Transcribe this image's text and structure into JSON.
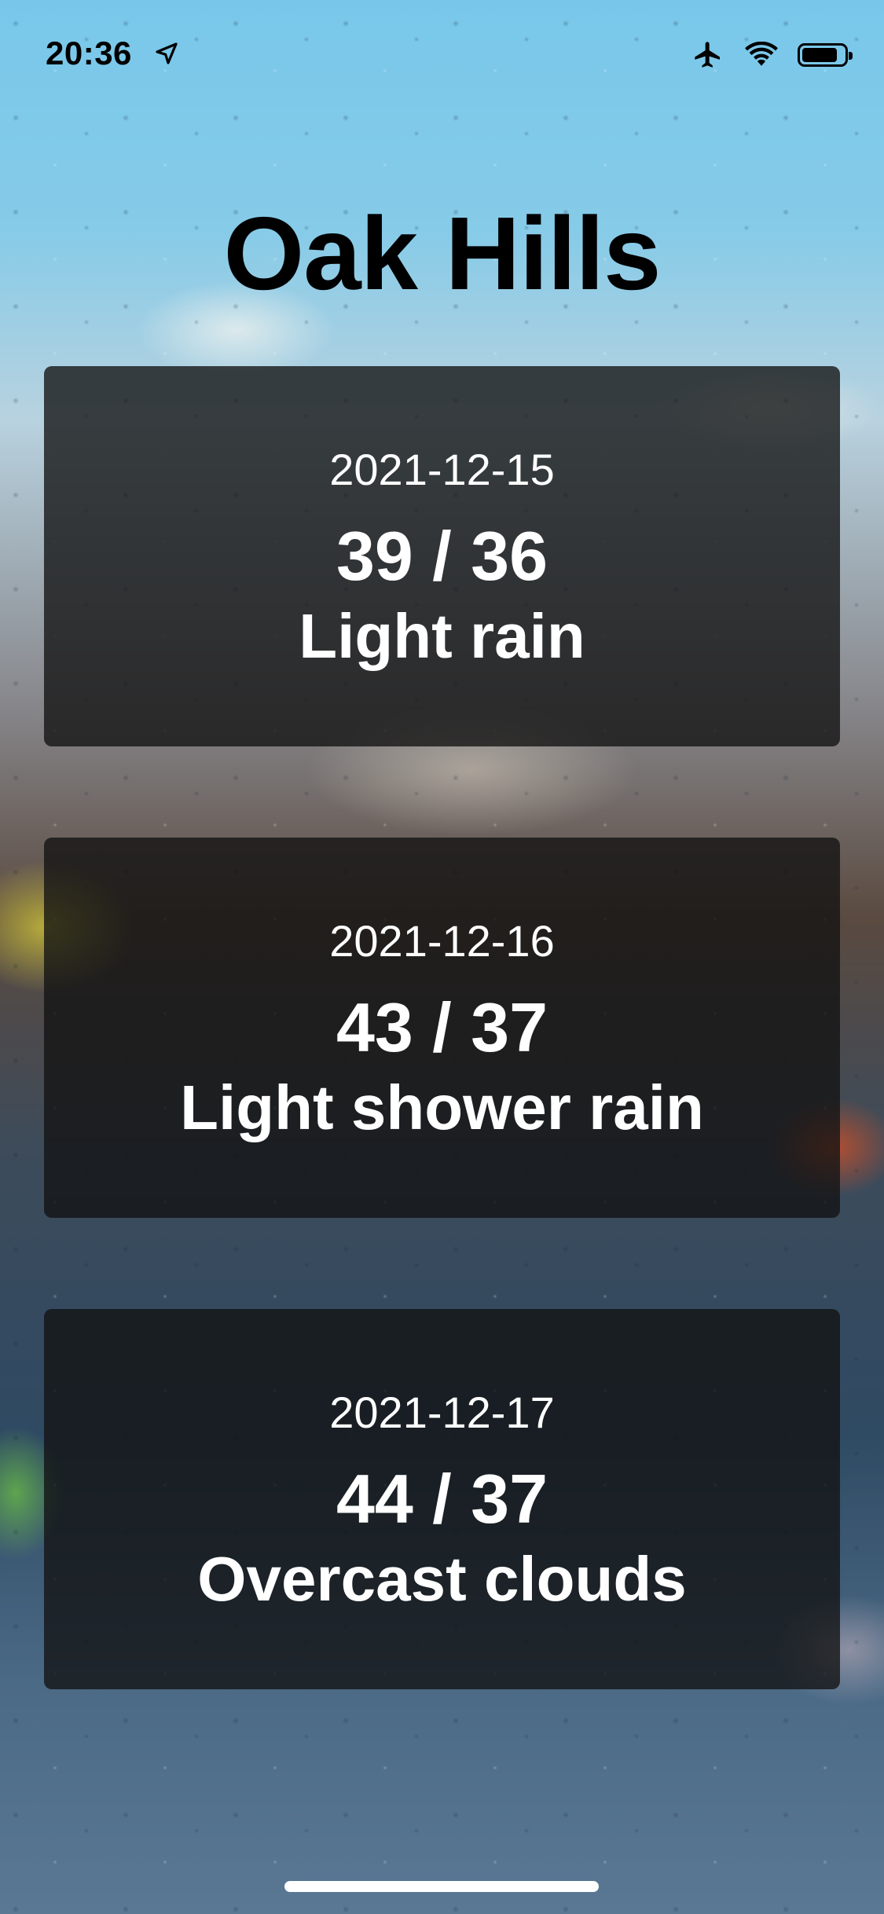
{
  "status_bar": {
    "time": "20:36",
    "icons": [
      "location-arrow-icon",
      "airplane-icon",
      "wifi-icon",
      "battery-icon"
    ],
    "battery_level": 0.85
  },
  "city": "Oak Hills",
  "forecast": [
    {
      "date": "2021-12-15",
      "temp": "39 / 36",
      "description": "Light rain"
    },
    {
      "date": "2021-12-16",
      "temp": "43 / 37",
      "description": "Light shower rain"
    },
    {
      "date": "2021-12-17",
      "temp": "44 / 37",
      "description": "Overcast clouds"
    }
  ],
  "colors": {
    "card_background": "#121212",
    "title_text": "#000000",
    "card_text": "#ffffff"
  }
}
